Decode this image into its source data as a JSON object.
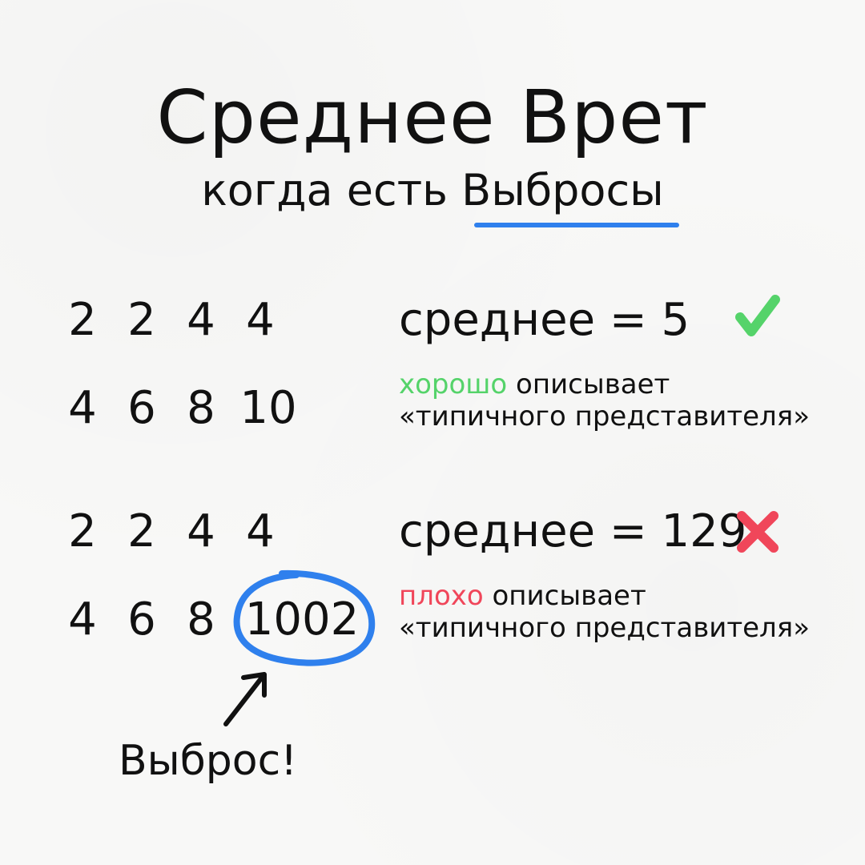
{
  "title": "Среднее Врет",
  "subtitle": "когда есть Выбросы",
  "example_good": {
    "row1": [
      "2",
      "2",
      "4",
      "4"
    ],
    "row2": [
      "4",
      "6",
      "8",
      "10"
    ],
    "formula": "среднее = 5",
    "verdict_word": "хорошо",
    "line1_rest": " описывает",
    "line2": "«типичного представителя»",
    "mark_icon": "check-icon",
    "mark_color": "#55d36a"
  },
  "example_bad": {
    "row1": [
      "2",
      "2",
      "4",
      "4"
    ],
    "row2": [
      "4",
      "6",
      "8",
      "1002"
    ],
    "formula": "среднее = 129",
    "verdict_word": "плохо",
    "line1_rest": " описывает",
    "line2": "«типичного представителя»",
    "mark_icon": "cross-icon",
    "mark_color": "#f0465a"
  },
  "outlier_label": "Выброс!",
  "colors": {
    "accent_blue": "#2f80ed",
    "good_green": "#55d36a",
    "bad_red": "#f0465a",
    "text": "#111111",
    "background": "#f8f8f7"
  }
}
